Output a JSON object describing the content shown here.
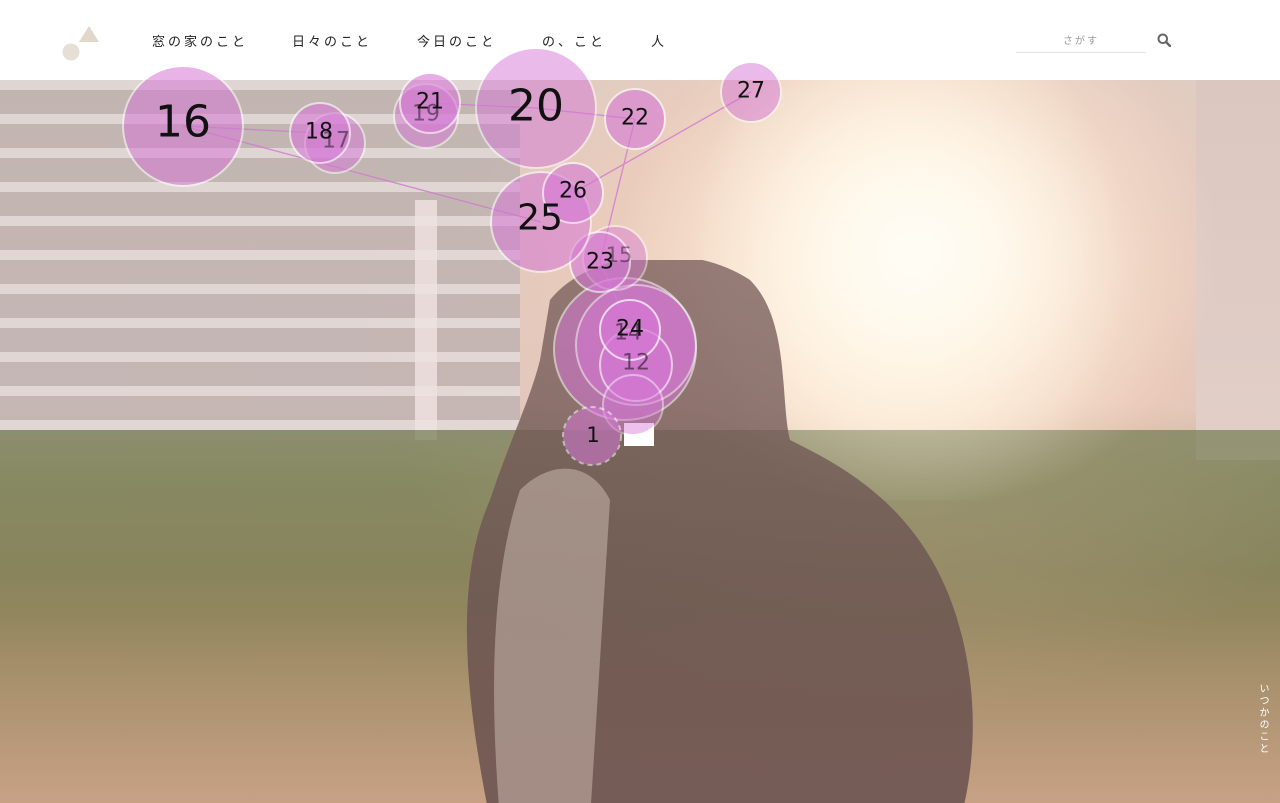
{
  "header": {
    "nav": [
      {
        "label": "窓の家のこと"
      },
      {
        "label": "日々のこと"
      },
      {
        "label": "今日のこと"
      },
      {
        "label": "の、こと"
      },
      {
        "label": "人"
      }
    ],
    "search_placeholder": "さがす"
  },
  "hero": {
    "caption": "いつかのこと"
  },
  "overlay": {
    "markers": [
      {
        "label": "1"
      },
      {
        "label": "12"
      },
      {
        "label": "14"
      },
      {
        "label": "15"
      },
      {
        "label": "16"
      },
      {
        "label": "17"
      },
      {
        "label": "18"
      },
      {
        "label": "19"
      },
      {
        "label": "20"
      },
      {
        "label": "21"
      },
      {
        "label": "22"
      },
      {
        "label": "23"
      },
      {
        "label": "24"
      },
      {
        "label": "25"
      },
      {
        "label": "26"
      },
      {
        "label": "27"
      }
    ]
  },
  "colors": {
    "bubble_fill": "#d678d6",
    "logo_circle": "#e7dfd6",
    "logo_triangle": "#e1d7cb"
  },
  "icons": [
    "logo-icon",
    "search-icon"
  ]
}
